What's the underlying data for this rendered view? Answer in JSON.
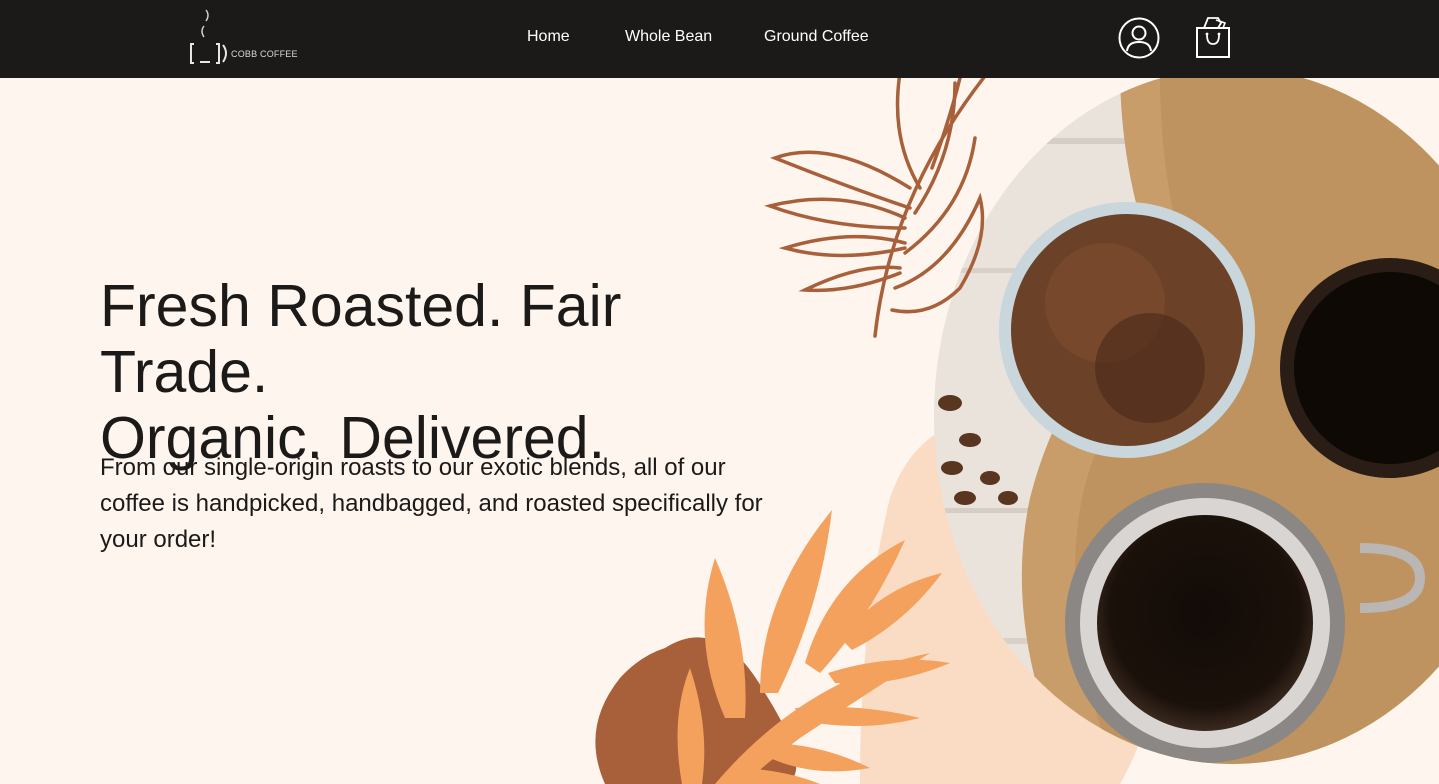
{
  "brand": {
    "name": "COBB COFFEE",
    "logo_glyph": "[_])"
  },
  "nav": {
    "items": [
      {
        "label": "Home"
      },
      {
        "label": "Whole Bean"
      },
      {
        "label": "Ground Coffee"
      }
    ],
    "account_icon": "user-circle-icon",
    "cart_icon": "shopping-bag-icon"
  },
  "hero": {
    "title_line1": "Fresh Roasted. Fair Trade.",
    "title_line2": "Organic. Delivered.",
    "body": "From our single-origin roasts to our exotic blends, all of our coffee is handpicked, handbagged, and roasted specifically for your order!"
  },
  "colors": {
    "navbar": "#1c1a19",
    "page_background": "#fdf5ee",
    "leaf_brown": "#a8603a",
    "leaf_orange": "#f4a15d",
    "blob_peach": "#f9dcc3"
  }
}
